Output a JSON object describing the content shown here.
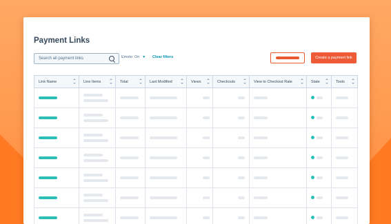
{
  "page": {
    "title": "Payment Links"
  },
  "toolbar": {
    "search_placeholder": "Search all payment links",
    "filter_label": "Emote: On",
    "filter_chevron": "▼",
    "clear_filters": "Clear filters",
    "create_button": "Create a payment link"
  },
  "table": {
    "columns": [
      "Link Name",
      "Line Items",
      "Total",
      "Last Modified",
      "Views",
      "Checkouts",
      "View to Checkout Rate",
      "State",
      "Tools"
    ],
    "row_count_visible": 7
  },
  "colors": {
    "brand_orange": "#ff8c3a",
    "primary_button": "#ee5a36",
    "teal": "#2cbfb7",
    "text_dark": "#33475b"
  }
}
